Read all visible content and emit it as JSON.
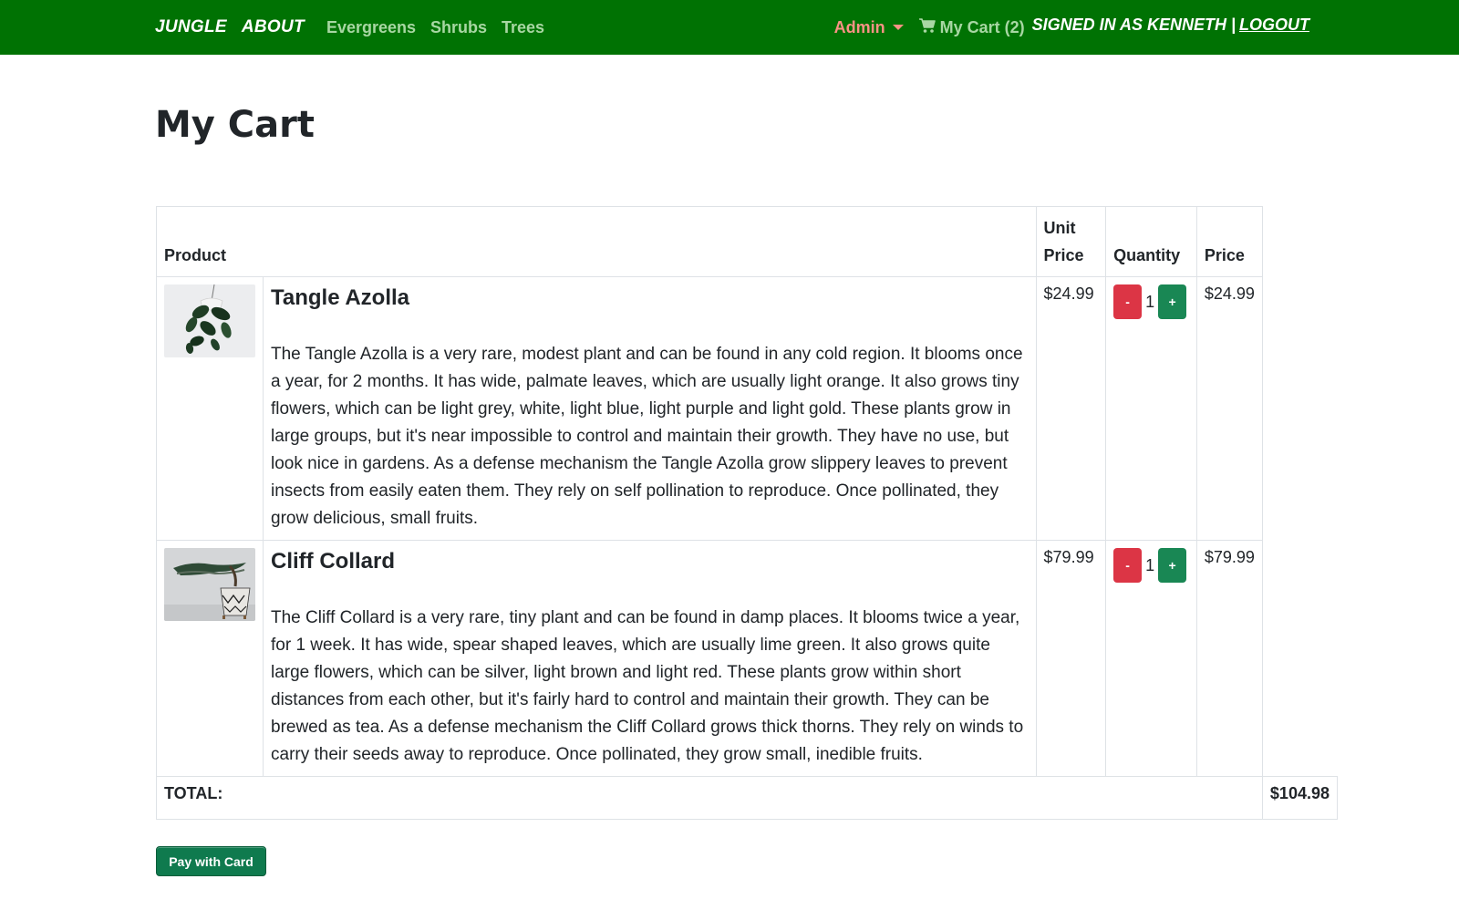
{
  "nav": {
    "brand1": "JUNGLE",
    "brand2": "ABOUT",
    "links": [
      "Evergreens",
      "Shrubs",
      "Trees"
    ],
    "admin": "Admin",
    "cart": "My Cart (2)",
    "signed_in": "SIGNED IN AS KENNETH |",
    "logout": "LOGOUT"
  },
  "page": {
    "title": "My Cart"
  },
  "table": {
    "headers": {
      "product": "Product",
      "unit_price_1": "Unit",
      "unit_price_2": "Price",
      "quantity": "Quantity",
      "price": "Price"
    },
    "rows": [
      {
        "name": "Tangle Azolla",
        "description": "The Tangle Azolla is a very rare, modest plant and can be found in any cold region. It blooms once a year, for 2 months. It has wide, palmate leaves, which are usually light orange. It also grows tiny flowers, which can be light grey, white, light blue, light purple and light gold. These plants grow in large groups, but it's near impossible to control and maintain their growth. They have no use, but look nice in gardens. As a defense mechanism the Tangle Azolla grow slippery leaves to prevent insects from easily eaten them. They rely on self pollination to reproduce. Once pollinated, they grow delicious, small fruits.",
        "unit_price": "$24.99",
        "quantity": "1",
        "price": "$24.99",
        "image_icon": "hanging-plant-image"
      },
      {
        "name": "Cliff Collard",
        "description": "The Cliff Collard is a very rare, tiny plant and can be found in damp places. It blooms twice a year, for 1 week. It has wide, spear shaped leaves, which are usually lime green. It also grows quite large flowers, which can be silver, light brown and light red. These plants grow within short distances from each other, but it's fairly hard to control and maintain their growth. They can be brewed as tea. As a defense mechanism the Cliff Collard grows thick thorns. They rely on winds to carry their seeds away to reproduce. Once pollinated, they grow small, inedible fruits.",
        "unit_price": "$79.99",
        "quantity": "1",
        "price": "$79.99",
        "image_icon": "bonsai-plant-image"
      }
    ],
    "minus_label": "-",
    "plus_label": "+",
    "total_label": "TOTAL:",
    "total_value": "$104.98"
  },
  "pay_button": "Pay with Card",
  "colors": {
    "navbar": "#007203",
    "nav_link": "#a8d7a3",
    "admin": "#fb9385",
    "minus": "#dc3545",
    "plus": "#198754",
    "pay": "#0f7a4e"
  }
}
